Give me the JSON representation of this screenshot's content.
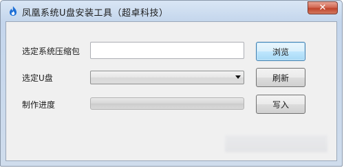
{
  "window": {
    "title": "凤凰系统U盘安装工具（超卓科技）",
    "close_glyph": "✕",
    "icon": "phoenix-flame-icon"
  },
  "form": {
    "system_label": "选定系统压缩包",
    "system_path_value": "",
    "usb_label": "选定U盘",
    "usb_selected": "",
    "progress_label": "制作进度",
    "progress_value": 0
  },
  "buttons": {
    "browse": "浏览",
    "refresh": "刷新",
    "write": "写入"
  },
  "colors": {
    "titlebar": "#c9d9ee",
    "client_bg": "#f0f0f0",
    "close_button": "#c9462f",
    "default_button_border": "#3c7fb1",
    "icon_blue": "#1d6fd6"
  }
}
